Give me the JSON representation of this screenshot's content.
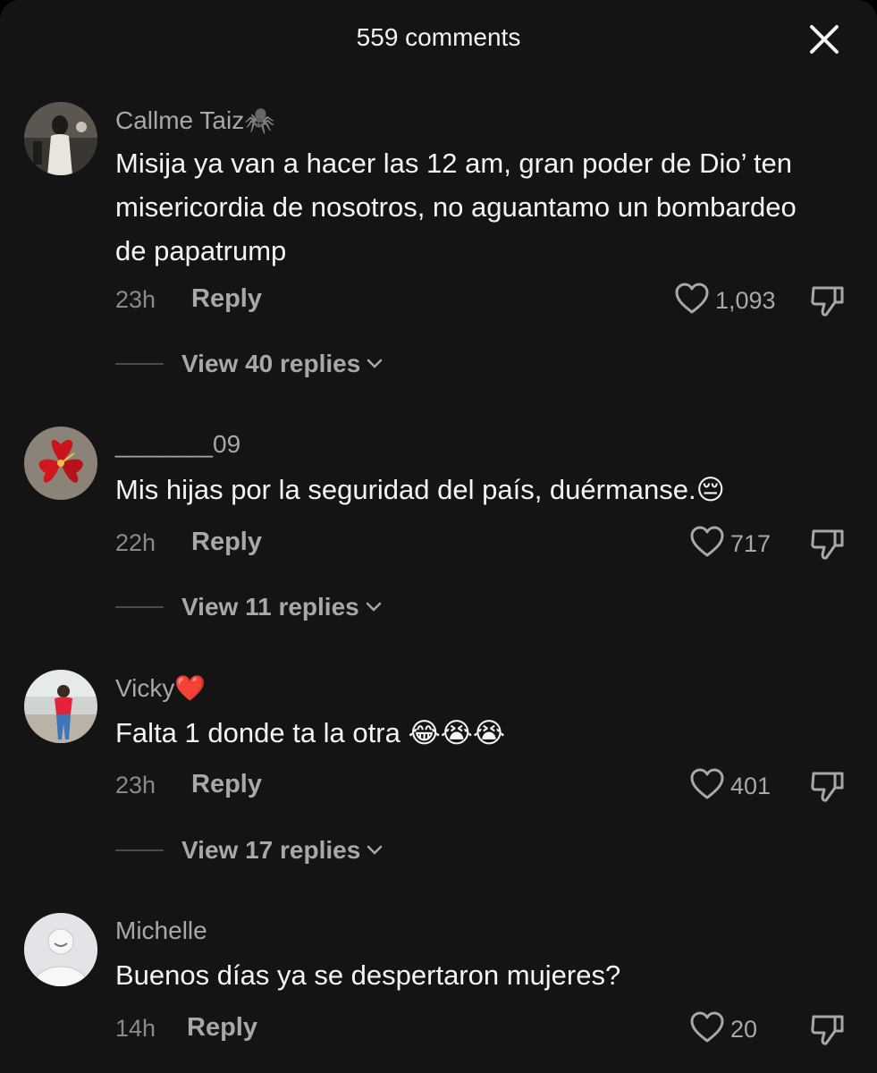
{
  "header": {
    "title": "559 comments",
    "close_icon": "close-icon"
  },
  "colors": {
    "background": "#141414",
    "primary_text": "#f4f4f4",
    "secondary_text": "#a8a8a8",
    "muted_text": "#8a8a8a"
  },
  "comments": [
    {
      "username": "Callme Taiz🕷️",
      "text": "Misija ya van a hacer las 12 am, gran poder de Dio’ ten misericordia de nosotros, no aguantamo un bombardeo de papatrump",
      "time": "23h",
      "reply_label": "Reply",
      "likes": "1,093",
      "view_replies": "View 40 replies",
      "avatar_icon": "avatar-photo"
    },
    {
      "username": "_______09",
      "text": "Mis hijas por la seguridad del país, duérmanse.😔",
      "time": "22h",
      "reply_label": "Reply",
      "likes": "717",
      "view_replies": "View 11 replies",
      "avatar_icon": "hibiscus-avatar"
    },
    {
      "username": "Vicky❤️",
      "text": "Falta 1 donde ta la otra 😂😭😭",
      "time": "23h",
      "reply_label": "Reply",
      "likes": "401",
      "view_replies": "View 17 replies",
      "avatar_icon": "avatar-photo"
    },
    {
      "username": "Michelle",
      "text": "Buenos días ya se despertaron mujeres?",
      "time": "14h",
      "reply_label": "Reply",
      "likes": "20",
      "avatar_icon": "default-avatar"
    }
  ]
}
